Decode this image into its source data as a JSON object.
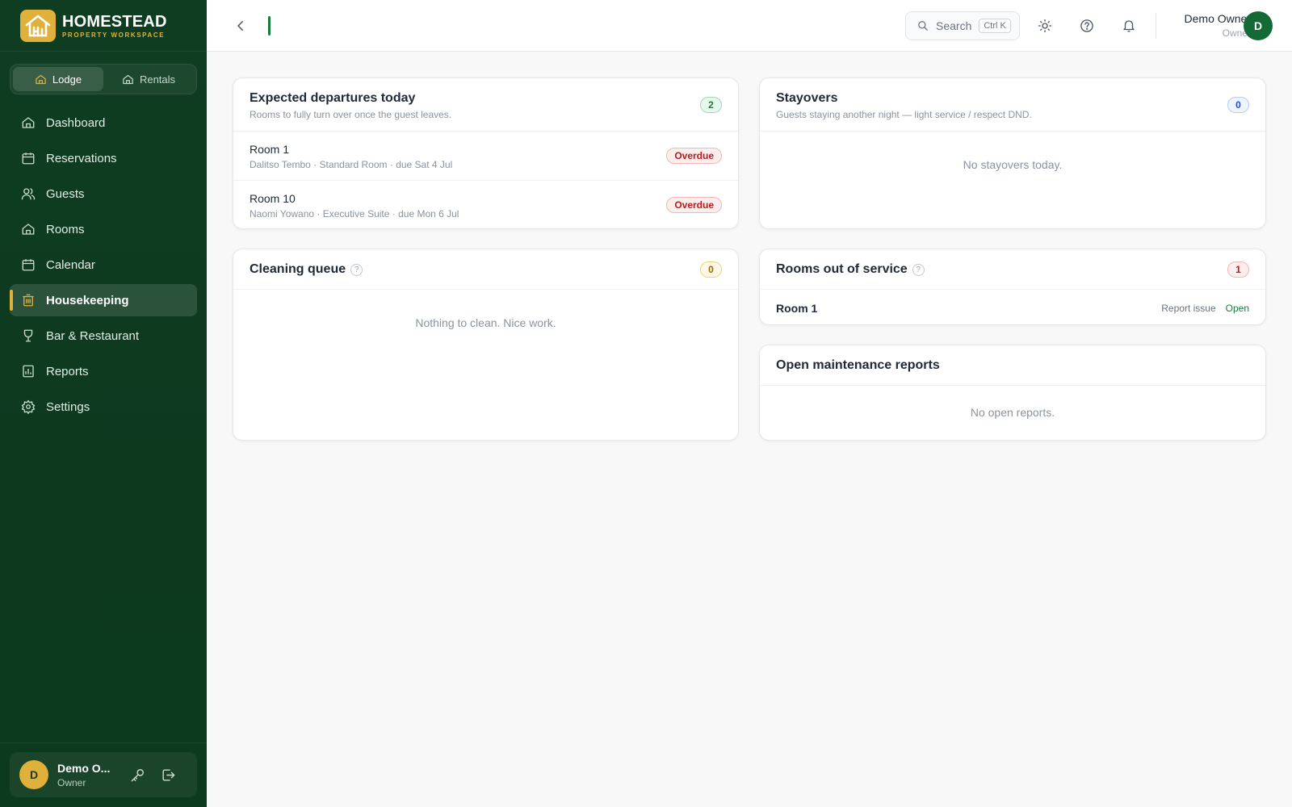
{
  "brand": {
    "name": "HOMESTEAD",
    "subtitle": "PROPERTY WORKSPACE"
  },
  "segment": {
    "lodge": "Lodge",
    "rentals": "Rentals"
  },
  "nav": {
    "dashboard": "Dashboard",
    "reservations": "Reservations",
    "guests": "Guests",
    "rooms": "Rooms",
    "calendar": "Calendar",
    "housekeeping": "Housekeeping",
    "bar": "Bar & Restaurant",
    "reports": "Reports",
    "settings": "Settings"
  },
  "sidebar_user": {
    "name": "Demo O...",
    "role": "Owner",
    "avatar": "D"
  },
  "topbar": {
    "search_label": "Search",
    "search_shortcut": "Ctrl K",
    "profile_name": "Demo Owner",
    "profile_role": "Owner",
    "profile_avatar": "D"
  },
  "departures": {
    "title": "Expected departures today",
    "subtitle": "Rooms to fully turn over once the guest leaves.",
    "count": "2",
    "rows": [
      {
        "room": "Room 1",
        "details": "Dalitso Tembo · Standard Room · due Sat 4 Jul",
        "status": "Overdue"
      },
      {
        "room": "Room 10",
        "details": "Naomi Yowano · Executive Suite · due Mon 6 Jul",
        "status": "Overdue"
      }
    ]
  },
  "stayovers": {
    "title": "Stayovers",
    "subtitle": "Guests staying another night — light service / respect DND.",
    "count": "0",
    "empty": "No stayovers today."
  },
  "cleaning": {
    "title": "Cleaning queue",
    "help": "?",
    "count": "0",
    "empty": "Nothing to clean. Nice work."
  },
  "out_of_service": {
    "title": "Rooms out of service",
    "help": "?",
    "count": "1",
    "rows": [
      {
        "room": "Room 1",
        "report_label": "Report issue",
        "open_label": "Open"
      }
    ]
  },
  "maintenance": {
    "title": "Open maintenance reports",
    "empty": "No open reports."
  },
  "colors": {
    "sidebar": "#0f3d22",
    "accent_gold": "#e0b13a",
    "accent_green": "#177a3c",
    "overdue_red": "#b91c1c"
  }
}
